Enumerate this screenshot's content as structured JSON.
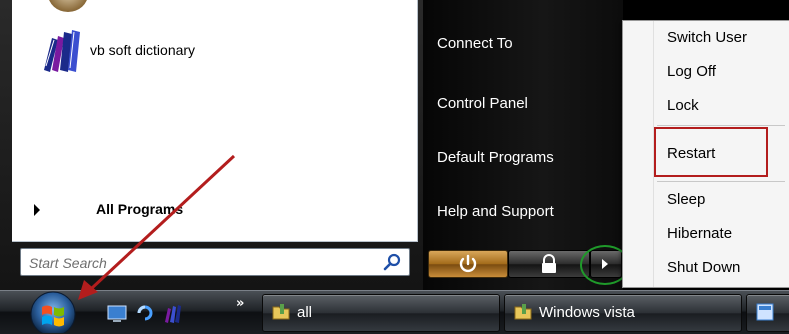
{
  "start_menu": {
    "programs": [
      {
        "label": "vb soft  dictionary",
        "icon": "books-icon"
      }
    ],
    "all_programs_label": "All Programs",
    "search": {
      "placeholder": "Start Search",
      "value": ""
    },
    "right_items": [
      {
        "label": "Connect To"
      },
      {
        "label": "Control Panel"
      },
      {
        "label": "Default Programs"
      },
      {
        "label": "Help and Support"
      }
    ],
    "power_buttons": [
      {
        "name": "power",
        "icon": "power-icon"
      },
      {
        "name": "lock",
        "icon": "lock-icon"
      },
      {
        "name": "more-options",
        "icon": "arrow-right-icon"
      }
    ]
  },
  "shutdown_submenu": {
    "items": [
      {
        "label": "Switch User"
      },
      {
        "label": "Log Off"
      },
      {
        "label": "Lock"
      },
      {
        "label": "Restart",
        "highlighted": true
      },
      {
        "label": "Sleep"
      },
      {
        "label": "Hibernate"
      },
      {
        "label": "Shut Down"
      }
    ]
  },
  "taskbar": {
    "quick_launch": [
      "show-desktop-icon",
      "switch-windows-icon",
      "books-icon"
    ],
    "quick_launch_more": "»",
    "tasks": [
      {
        "label": "all",
        "icon": "folder-icon"
      },
      {
        "label": "Windows vista",
        "icon": "folder-icon"
      },
      {
        "label": "",
        "icon": "app-icon"
      }
    ]
  },
  "annotations": {
    "highlight_color": "#b31d1d",
    "ring_color": "#1f9a2a",
    "arrow_color": "#b31d1d"
  }
}
